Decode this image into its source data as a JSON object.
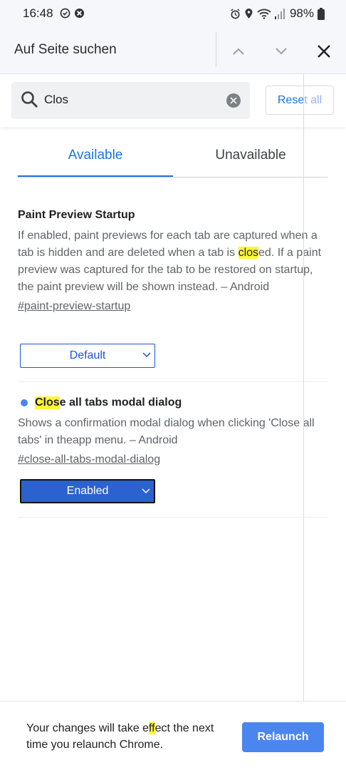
{
  "status_bar": {
    "time": "16:48",
    "battery": "98%"
  },
  "find_bar": {
    "title": "Auf Seite suchen"
  },
  "search": {
    "value": "Clos"
  },
  "reset_button": {
    "label_main": "Rese",
    "label_tail": "t all"
  },
  "tabs": [
    {
      "label": "Available",
      "active": true
    },
    {
      "label": "Unavailable",
      "active": false
    }
  ],
  "experiments": [
    {
      "title": "Paint Preview Startup",
      "desc_before": "If enabled, paint previews for each tab are captured when a tab is hidden and are deleted when a tab is ",
      "desc_highlight": "clos",
      "desc_after": "ed. If a paint preview was captured for the tab to be restored on startup, the paint preview will be shown instead. – Android",
      "link": "#paint-preview-startup",
      "select_value": "Default"
    },
    {
      "title_highlight": "Clos",
      "title_rest": "e all tabs modal dialog",
      "description": "Shows a confirmation modal dialog when clicking 'Close all tabs' in theapp menu. – Android",
      "link": "#close-all-tabs-modal-dialog",
      "select_value": "Enabled"
    }
  ],
  "bottom_bar": {
    "msg_before": "Your changes will take e",
    "msg_highlight": "ff",
    "msg_after": "ect the next time you relaunch Chrome.",
    "relaunch_label": "Relaunch"
  },
  "colors": {
    "accent": "#1a73e8",
    "highlight": "#fff63a",
    "relaunch_bg": "#4b86f0",
    "enabled_select_bg": "#2b62cf"
  }
}
